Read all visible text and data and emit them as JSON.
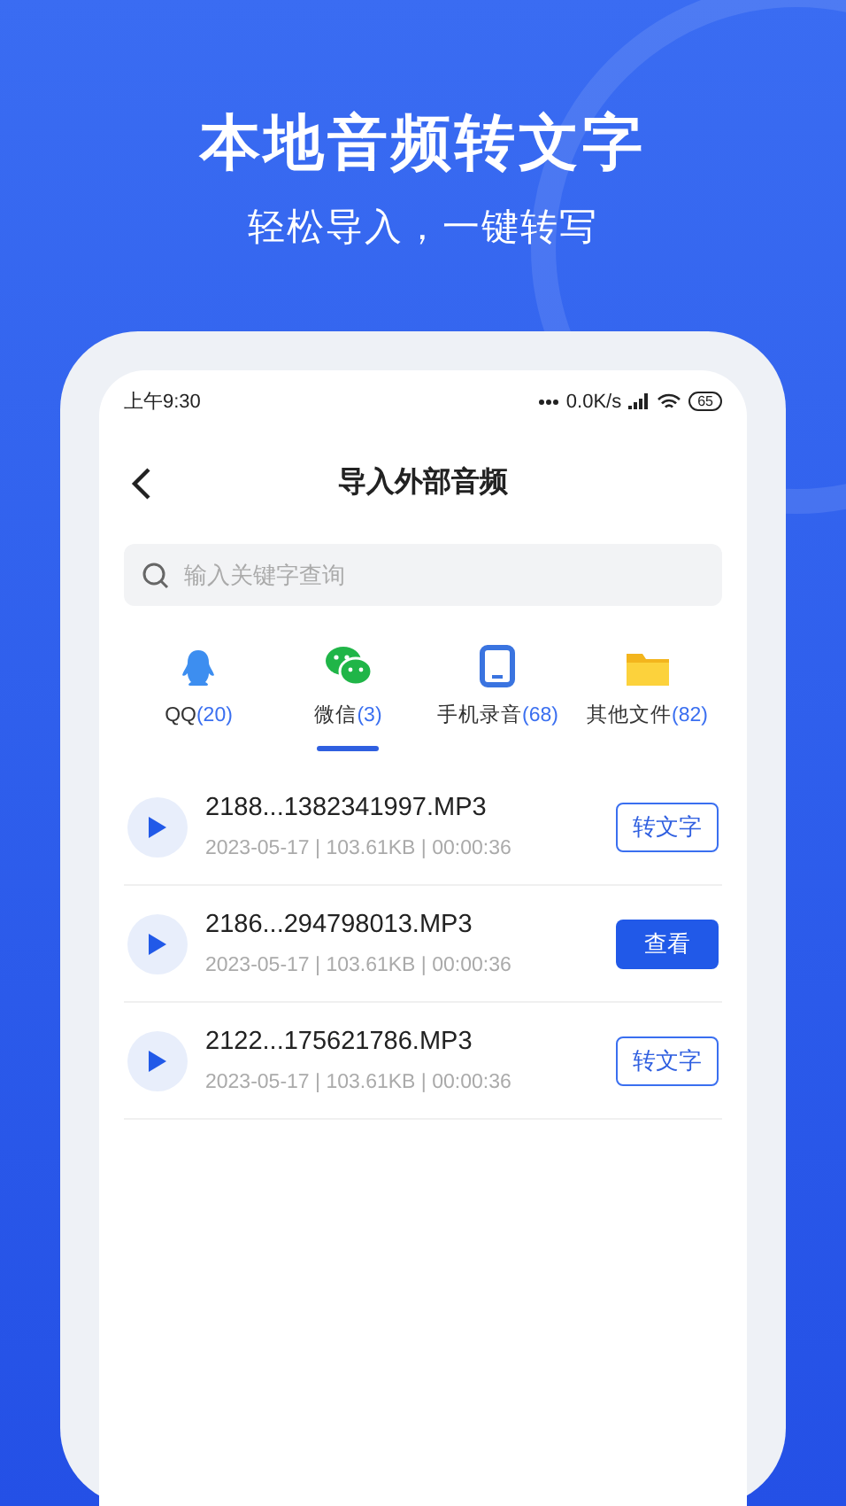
{
  "headline": {
    "title": "本地音频转文字",
    "subtitle": "轻松导入，一键转写"
  },
  "status_bar": {
    "time": "上午9:30",
    "speed": "0.0K/s",
    "battery": "65"
  },
  "header": {
    "title": "导入外部音频"
  },
  "search": {
    "placeholder": "输入关键字查询"
  },
  "tabs": [
    {
      "kind": "penguin",
      "label": "QQ",
      "count": "(20)",
      "selected": false
    },
    {
      "kind": "chat",
      "label": "微信",
      "count": "(3)",
      "selected": true
    },
    {
      "kind": "phone",
      "label": "手机录音",
      "count": "(68)",
      "selected": false
    },
    {
      "kind": "folder",
      "label": "其他文件",
      "count": "(82)",
      "selected": false
    }
  ],
  "files": [
    {
      "name": "2188...1382341997.MP3",
      "meta": "2023-05-17 | 103.61KB | 00:00:36",
      "action": {
        "kind": "outline",
        "label": "转文字"
      }
    },
    {
      "name": "2186...294798013.MP3",
      "meta": "2023-05-17 | 103.61KB | 00:00:36",
      "action": {
        "kind": "filled",
        "label": "查看"
      }
    },
    {
      "name": "2122...175621786.MP3",
      "meta": "2023-05-17 | 103.61KB | 00:00:36",
      "action": {
        "kind": "outline",
        "label": "转文字"
      }
    }
  ]
}
